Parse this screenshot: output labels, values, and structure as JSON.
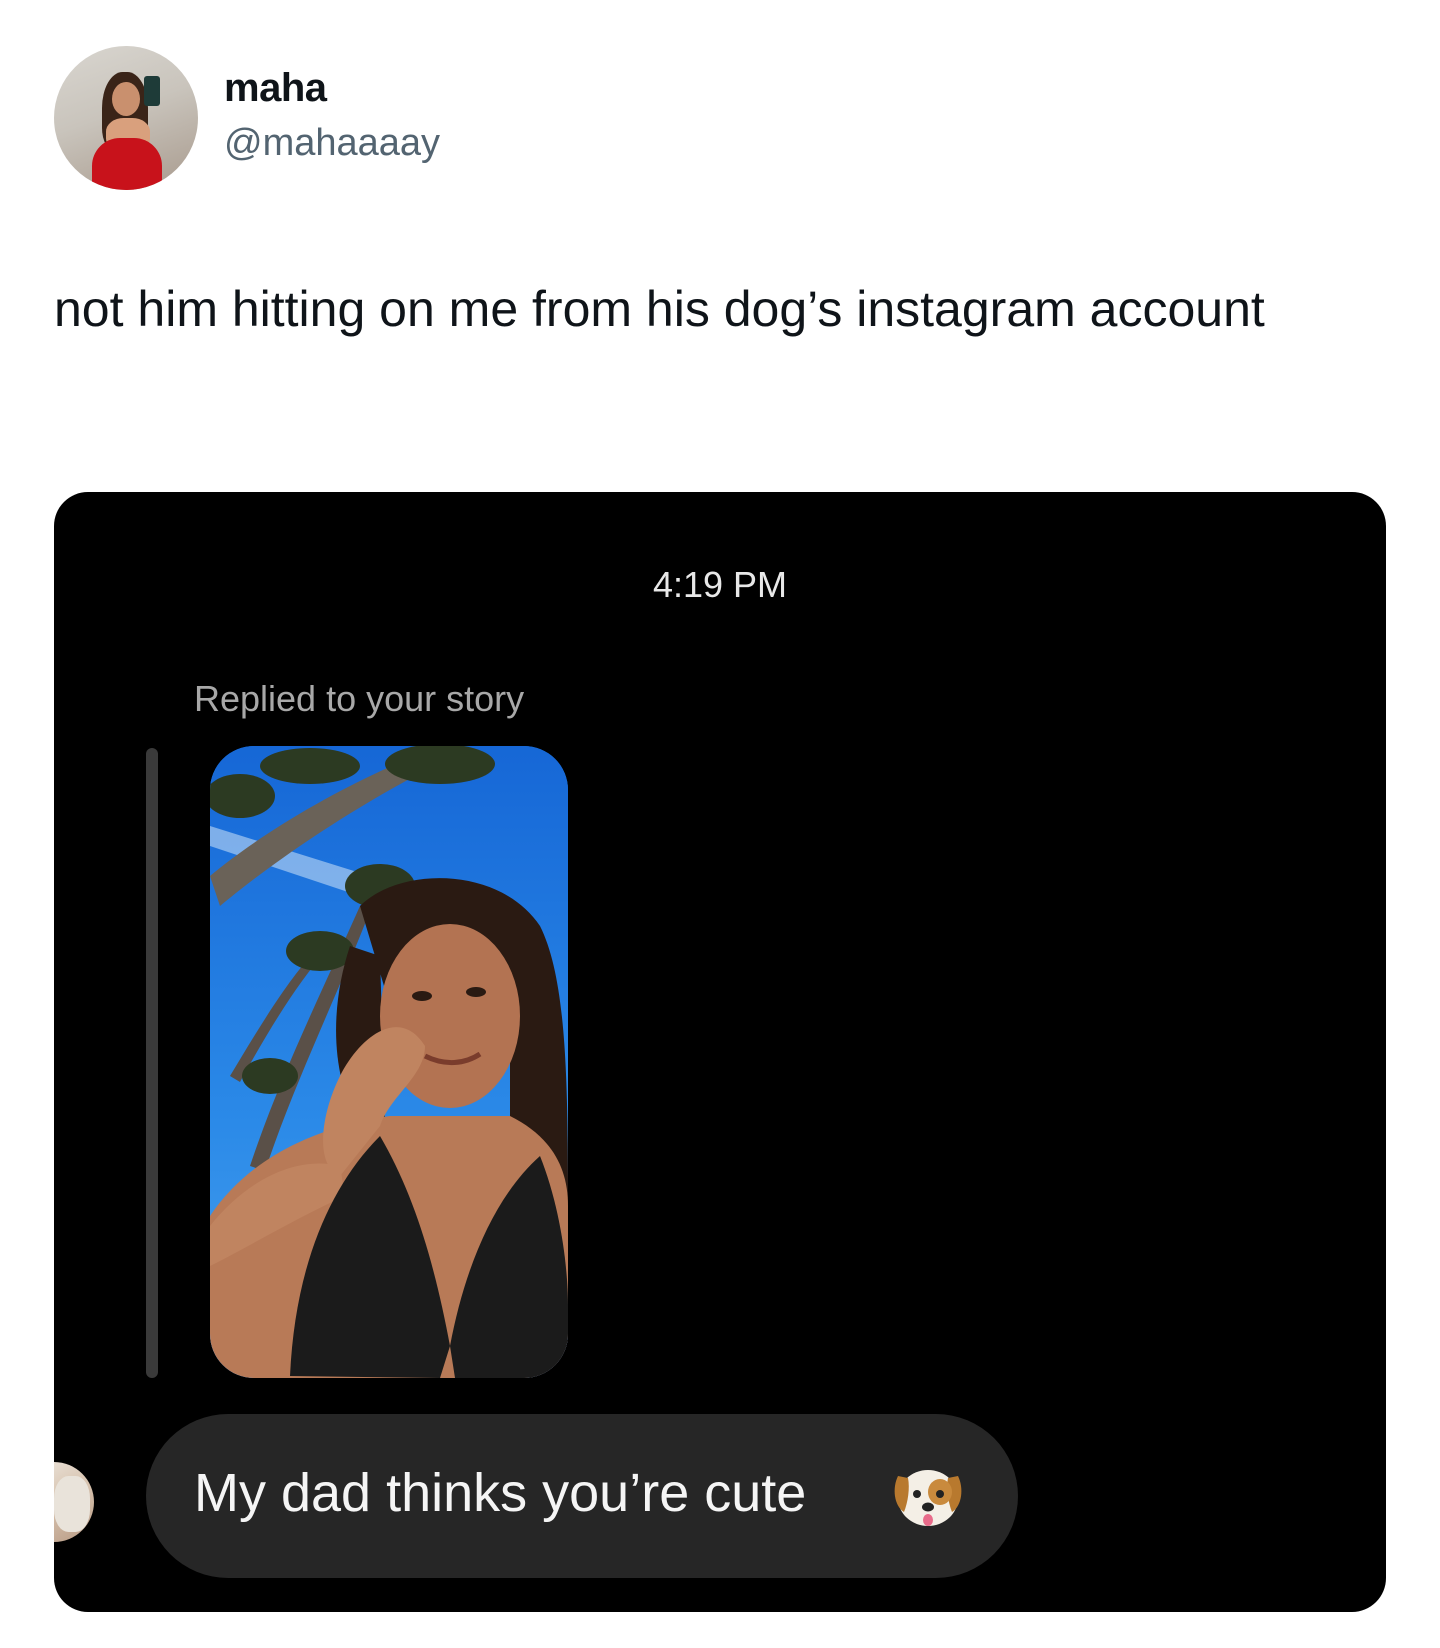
{
  "author": {
    "display_name": "maha",
    "handle": "@mahaaaay"
  },
  "tweet": {
    "text": "not him hitting on me from his dog’s instagram account"
  },
  "dm_screenshot": {
    "timestamp": "4:19 PM",
    "reply_label": "Replied to your story",
    "message": "My dad thinks you’re cute",
    "emoji": "dog-face-emoji",
    "background": "#000000",
    "bubble_color": "#262626"
  }
}
